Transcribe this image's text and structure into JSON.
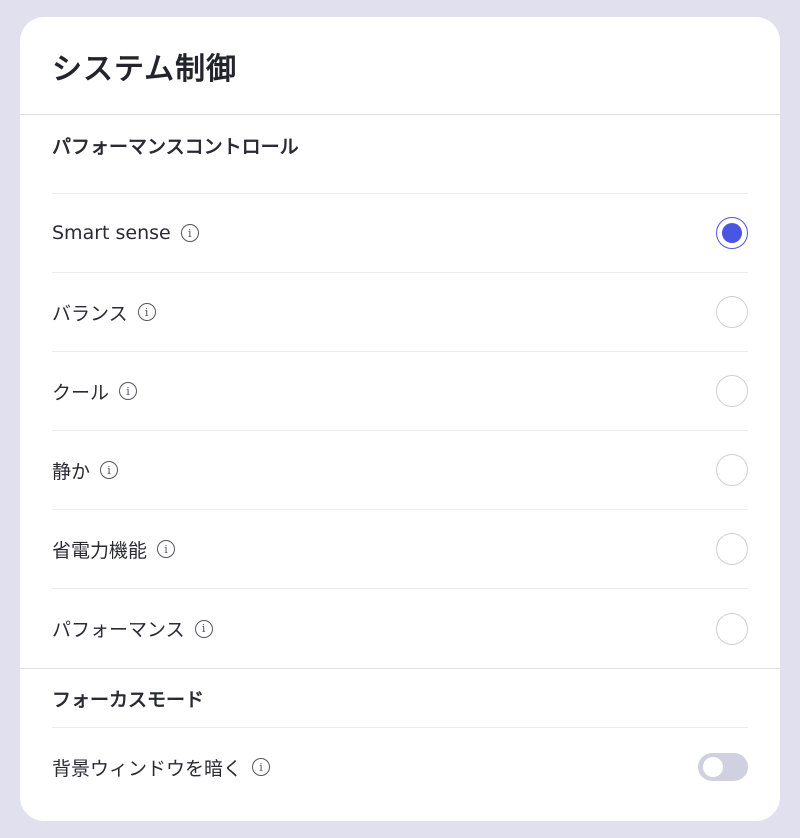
{
  "panel": {
    "title": "システム制御"
  },
  "performance": {
    "title": "パフォーマンスコントロール",
    "options": [
      {
        "label": "Smart sense",
        "selected": true
      },
      {
        "label": "バランス",
        "selected": false
      },
      {
        "label": "クール",
        "selected": false
      },
      {
        "label": "静か",
        "selected": false
      },
      {
        "label": "省電力機能",
        "selected": false
      },
      {
        "label": "パフォーマンス",
        "selected": false
      }
    ]
  },
  "focus": {
    "title": "フォーカスモード",
    "dim_label": "背景ウィンドウを暗く",
    "dim_enabled": false
  },
  "icons": {
    "info_glyph": "i"
  },
  "colors": {
    "accent": "#4a56e2",
    "background": "#e1e0ef",
    "toggle_off": "#cfd0e0"
  }
}
